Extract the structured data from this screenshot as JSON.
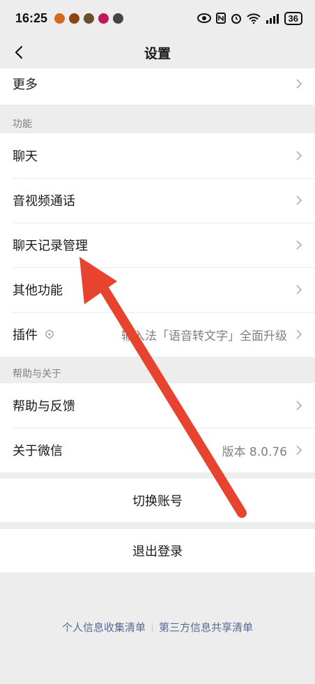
{
  "status_bar": {
    "time": "16:25",
    "battery": "36",
    "icons": [
      "eye-icon",
      "nfc-icon",
      "alarm-icon",
      "wifi-icon",
      "signal-icon"
    ]
  },
  "nav": {
    "title": "设置",
    "back_icon": "chevron-left-icon"
  },
  "top_group": {
    "items": [
      {
        "label": "更多"
      }
    ]
  },
  "features": {
    "section_label": "功能",
    "items": [
      {
        "label": "聊天"
      },
      {
        "label": "音视频通话"
      },
      {
        "label": "聊天记录管理"
      },
      {
        "label": "其他功能"
      },
      {
        "label": "插件",
        "value": "输入法「语音转文字」全面升级",
        "icon": "plugin-icon"
      }
    ]
  },
  "help": {
    "section_label": "帮助与关于",
    "items": [
      {
        "label": "帮助与反馈"
      },
      {
        "label": "关于微信",
        "value": "版本 8.0.76"
      }
    ]
  },
  "actions": {
    "switch_account": "切换账号",
    "logout": "退出登录"
  },
  "footer": {
    "personal_info": "个人信息收集清单",
    "third_party": "第三方信息共享清单"
  },
  "colors": {
    "background": "#ededed",
    "link": "#576b95",
    "annotation_arrow": "#e8432e"
  }
}
